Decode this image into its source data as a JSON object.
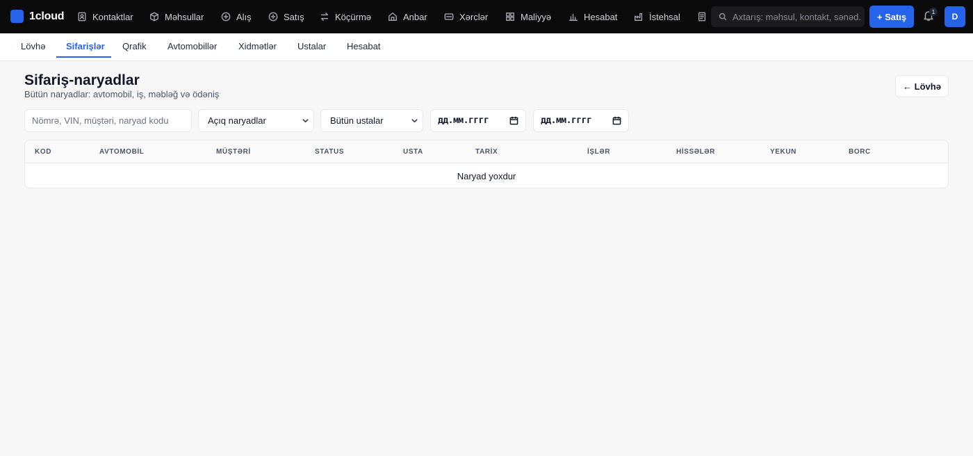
{
  "app": {
    "name": "1cloud"
  },
  "nav": {
    "items": [
      {
        "label": "Kontaktlar",
        "icon": "contacts-icon"
      },
      {
        "label": "Məhsullar",
        "icon": "box-icon"
      },
      {
        "label": "Alış",
        "icon": "plus-circle-icon"
      },
      {
        "label": "Satış",
        "icon": "plus-circle-icon"
      },
      {
        "label": "Köçürmə",
        "icon": "transfer-icon"
      },
      {
        "label": "Anbar",
        "icon": "home-icon"
      },
      {
        "label": "Xərclər",
        "icon": "bill-icon"
      },
      {
        "label": "Maliyyə",
        "icon": "grid-icon"
      },
      {
        "label": "Hesabat",
        "icon": "bar-chart-icon"
      },
      {
        "label": "İstehsal",
        "icon": "factory-icon"
      }
    ],
    "search_placeholder": "Axtarış: məhsul, kontakt, sənəd...",
    "new_sale_label": "+ Satış",
    "notification_count": "1",
    "avatar_initial": "D"
  },
  "tabs": [
    {
      "label": "Lövhə",
      "active": false
    },
    {
      "label": "Sifarişlər",
      "active": true
    },
    {
      "label": "Qrafik",
      "active": false
    },
    {
      "label": "Avtomobillər",
      "active": false
    },
    {
      "label": "Xidmətlər",
      "active": false
    },
    {
      "label": "Ustalar",
      "active": false
    },
    {
      "label": "Hesabat",
      "active": false
    }
  ],
  "page": {
    "title": "Sifariş-naryadlar",
    "subtitle": "Bütün naryadlar: avtomobil, iş, məbləğ və ödəniş",
    "back_label": "← Lövhə"
  },
  "filters": {
    "search_placeholder": "Nömrə, VIN, müştəri, naryad kodu",
    "status_value": "Açıq naryadlar",
    "master_value": "Bütün ustalar",
    "date_from_placeholder": "дд.мм.гггг",
    "date_to_placeholder": "дд.мм.гггг"
  },
  "table": {
    "columns": [
      "KOD",
      "AVTOMOBİL",
      "MÜŞTƏRİ",
      "STATUS",
      "USTA",
      "TARİX",
      "İŞLƏR",
      "HİSSƏLƏR",
      "YEKUN",
      "BORC"
    ],
    "empty_message": "Naryad yoxdur"
  },
  "colors": {
    "accent": "#2563eb",
    "topbar": "#0b0b0c",
    "background": "#f7f7f8"
  }
}
